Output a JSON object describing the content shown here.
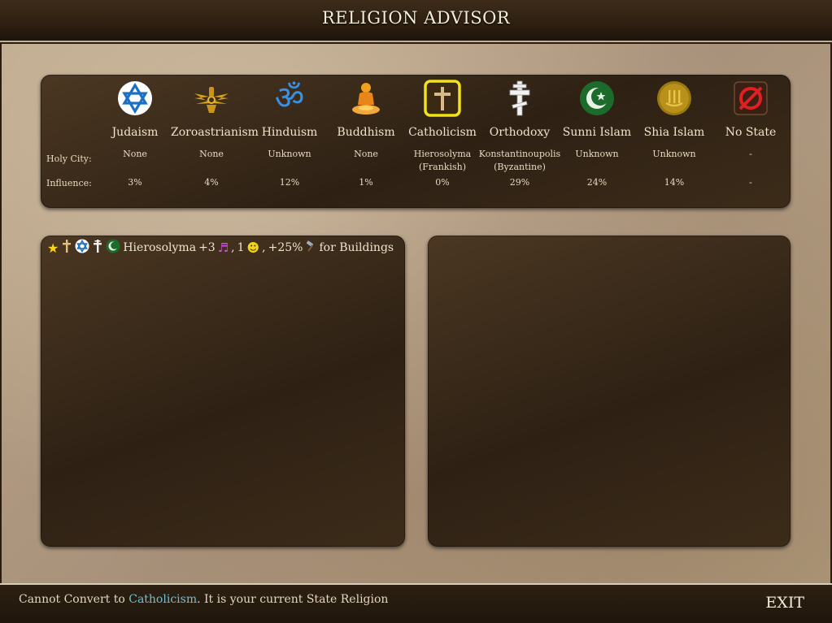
{
  "window": {
    "title": "RELIGION ADVISOR"
  },
  "row_labels": {
    "holy_city": "Holy City:",
    "influence": "Influence:"
  },
  "religions": [
    {
      "name": "Judaism",
      "icon": "star-of-david-icon",
      "holy_city": "None",
      "holy_city_owner": "",
      "influence": "3%"
    },
    {
      "name": "Zoroastrianism",
      "icon": "faravahar-icon",
      "holy_city": "None",
      "holy_city_owner": "",
      "influence": "4%"
    },
    {
      "name": "Hinduism",
      "icon": "om-icon",
      "holy_city": "Unknown",
      "holy_city_owner": "",
      "influence": "12%"
    },
    {
      "name": "Buddhism",
      "icon": "buddha-icon",
      "holy_city": "None",
      "holy_city_owner": "",
      "influence": "1%"
    },
    {
      "name": "Catholicism",
      "icon": "catholic-cross-icon",
      "holy_city": "Hierosolyma",
      "holy_city_owner": "(Frankish)",
      "influence": "0%",
      "selected": true
    },
    {
      "name": "Orthodoxy",
      "icon": "orthodox-cross-icon",
      "holy_city": "Konstantinoupolis",
      "holy_city_owner": "(Byzantine)",
      "influence": "29%"
    },
    {
      "name": "Sunni Islam",
      "icon": "crescent-star-icon",
      "holy_city": "Unknown",
      "holy_city_owner": "",
      "influence": "24%"
    },
    {
      "name": "Shia Islam",
      "icon": "allah-script-icon",
      "holy_city": "Unknown",
      "holy_city_owner": "",
      "influence": "14%"
    },
    {
      "name": "No State",
      "icon": "no-religion-icon",
      "holy_city": "-",
      "holy_city_owner": "",
      "influence": "-"
    }
  ],
  "holy_cities": {
    "entry": {
      "icons": [
        "star-icon",
        "catholic-cross-icon",
        "star-of-david-icon",
        "orthodox-cross-icon",
        "crescent-star-icon"
      ],
      "city": "Hierosolyma",
      "bonus_culture": "+3",
      "bonus_happy": "1",
      "bonus_production": "+25%",
      "suffix": "for Buildings",
      "sep": ","
    }
  },
  "status": {
    "prefix": "Cannot Convert to",
    "religion": "Catholicism",
    "suffix": ". It is your current State Religion"
  },
  "exit_label": "EXIT",
  "colors": {
    "highlight": "#6fc0d6",
    "selected_frame": "#f2e21a",
    "panel": "#3a2a18"
  }
}
